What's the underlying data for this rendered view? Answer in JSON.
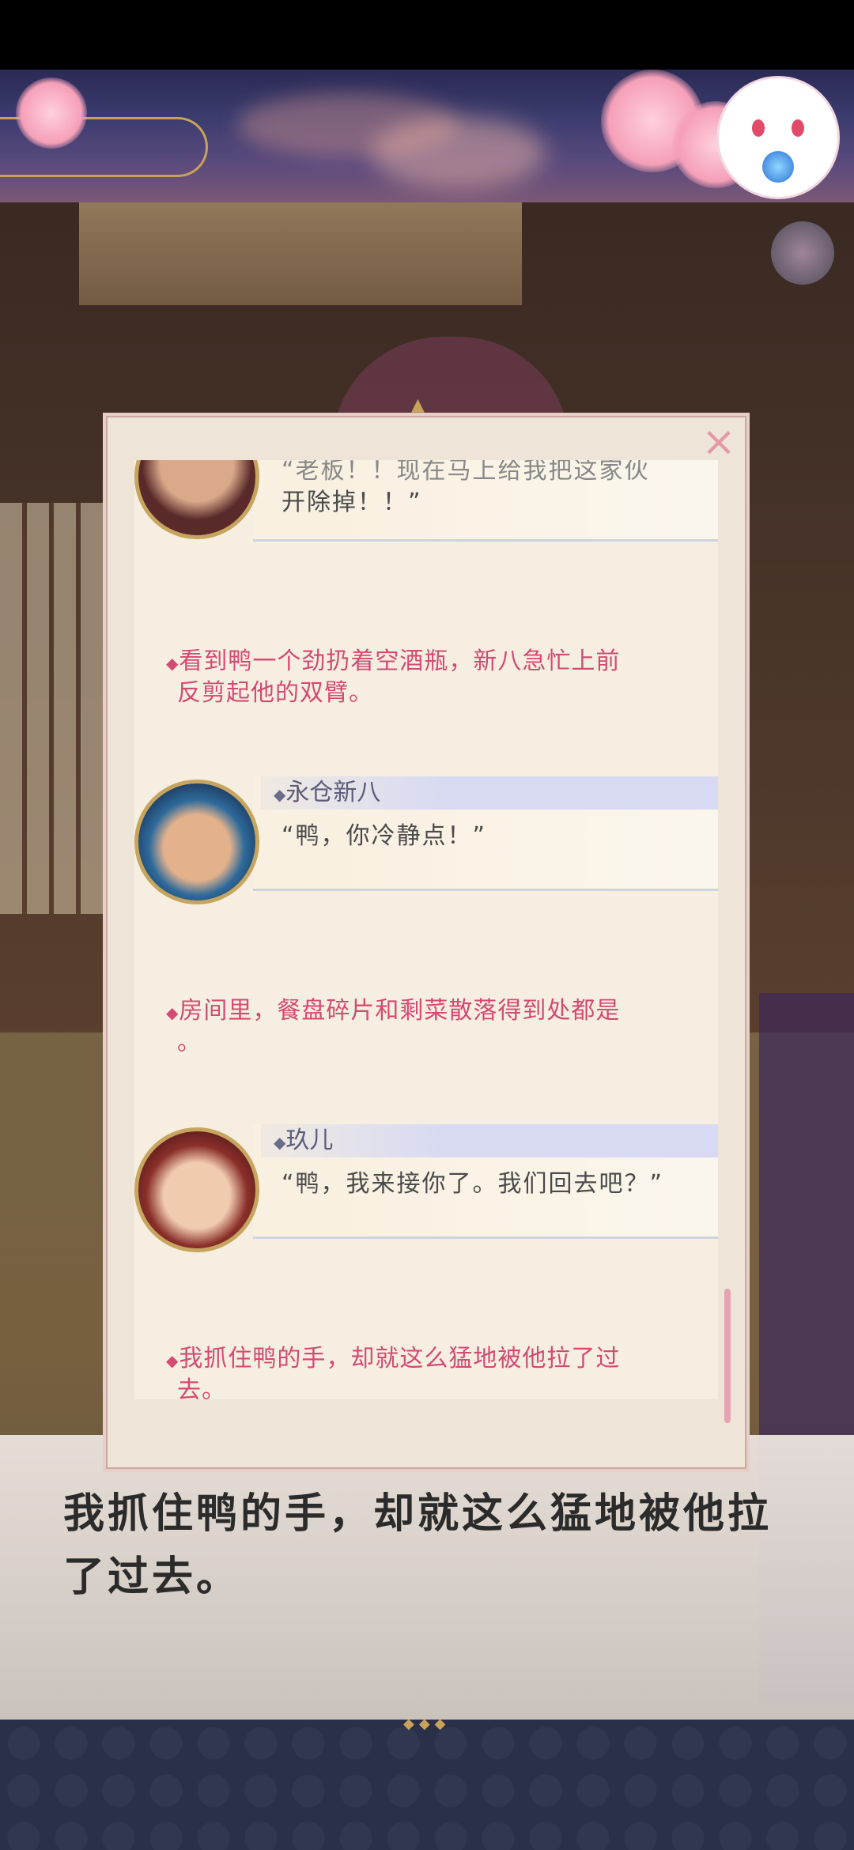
{
  "backlog": {
    "entries": [
      {
        "type": "speech",
        "speaker": "",
        "text": "“老板！！现在马上给我把这家伙",
        "text2": "开除掉！！”"
      },
      {
        "type": "narration",
        "text": "看到鸭一个劲扔着空酒瓶，新八急忙上前",
        "text2": "反剪起他的双臂。"
      },
      {
        "type": "speech",
        "speaker": "永仓新八",
        "text": "“鸭，你冷静点！”"
      },
      {
        "type": "narration",
        "text": "房间里，餐盘碎片和剩菜散落得到处都是",
        "text2": "。"
      },
      {
        "type": "speech",
        "speaker": "玖儿",
        "text": "“鸭，我来接你了。我们回去吧？”"
      },
      {
        "type": "narration",
        "text": "我抓住鸭的手，却就这么猛地被他拉了过",
        "text2": "去。"
      }
    ],
    "close_icon": "×"
  },
  "dialogue": {
    "line1": "我抓住鸭的手，却就这么猛地被他拉",
    "line2": "了过去。"
  },
  "icons": {
    "close": "close-icon",
    "bullet": "◆"
  },
  "colors": {
    "narration": "#d34a72",
    "panel": "#f6efe1",
    "name_bar": "#d7daf2"
  }
}
